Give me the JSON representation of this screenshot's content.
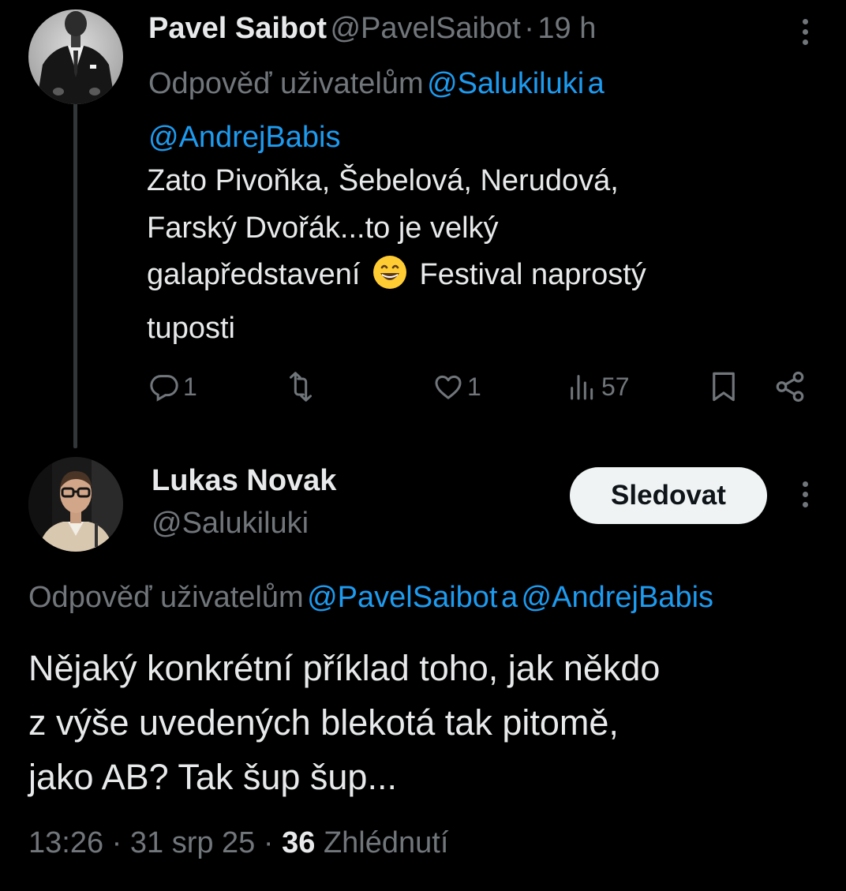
{
  "reply_tweet": {
    "author_name": "Pavel Saibot",
    "author_handle": "@PavelSaibot",
    "separator": "·",
    "time": "19 h",
    "reply_prefix": "Odpověď uživatelům",
    "reply_mention_1": "@Salukiluki",
    "reply_and": "a",
    "reply_mention_2": "@AndrejBabis",
    "text_lines": [
      "Zato Pivoňka, Šebelová, Nerudová,",
      "Farský Dvořák...to je velký",
      "galapředstavení",
      "Festival naprostý",
      "tuposti"
    ],
    "emoji": "😄",
    "actions": {
      "replies": "1",
      "retweets": "",
      "likes": "1",
      "views": "57"
    },
    "icons": [
      "reply-icon",
      "retweet-icon",
      "like-icon",
      "views-icon",
      "bookmark-icon",
      "share-icon",
      "more-icon"
    ]
  },
  "main_tweet": {
    "author_name": "Lukas Novak",
    "author_handle": "@Salukiluki",
    "follow_label": "Sledovat",
    "reply_prefix": "Odpověď uživatelům",
    "reply_mention_1": "@PavelSaibot",
    "reply_and": "a",
    "reply_mention_2": "@AndrejBabis",
    "text_lines": [
      "Nějaký konkrétní příklad toho, jak někdo",
      "z výše uvedených blekotá tak pitomě,",
      "jako AB? Tak šup šup..."
    ],
    "timestamp_time": "13:26",
    "separator": "·",
    "timestamp_date": "31 srp 25",
    "views_count": "36",
    "views_label": "Zhlédnutí"
  },
  "colors": {
    "background": "#000000",
    "text": "#e7e9ea",
    "muted": "#71767b",
    "link": "#1d9bf0",
    "button_bg": "#eff3f4",
    "thread_line": "#333639"
  }
}
